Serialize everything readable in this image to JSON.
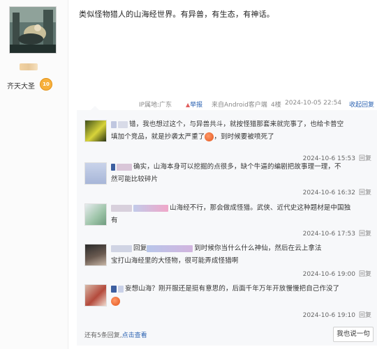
{
  "user": {
    "name": "齐天大圣",
    "level": "10"
  },
  "post": {
    "text": "类似怪物猎人的山海经世界。有异兽，有生态，有神话。"
  },
  "meta": {
    "ip_location": "IP属地:广东",
    "report": "举报",
    "client": "来自Android客户端",
    "floor": "4楼",
    "datetime": "2024-10-05 22:54",
    "collapse": "收起回复"
  },
  "replies": [
    {
      "name_fragment": "错",
      "text_a": "，我也想过这个，与异兽共斗，就按怪猎那套来就完事了，也给卡普空",
      "text_b": "填加个竞品，就是抄袭太严重了",
      "text_c": "，到时候要被喷死了",
      "time": "2024-10-6 15:53",
      "reply_label": "回复"
    },
    {
      "text_a": "确实，山海本身可以挖掘的点很多，缺个牛逼的编剧把故事理一理，不",
      "text_b": "然可能比较碎片",
      "time": "2024-10-6 16:32",
      "reply_label": "回复"
    },
    {
      "text_a": "山海经不行，那会做成怪猎。武侠、近代史这种题材是中国独",
      "text_b": "有",
      "time": "2024-10-6 17:53",
      "reply_label": "回复"
    },
    {
      "prefix": "回复",
      "text_a": "到时候你当什么什么神仙，然后在云上拿法",
      "text_b": "宝打山海经里的大怪物，很可能弄成怪猎啊",
      "time": "2024-10-6 19:00",
      "reply_label": "回复"
    },
    {
      "text_a": "妄想山海？刚开服还是挺有意思的，后面千年万年开放慢慢把自己作没了",
      "time": "2024-10-6 19:10",
      "reply_label": "回复"
    }
  ],
  "footer": {
    "more_text": "还有5条回复,",
    "view_link": "点击查看",
    "say_button": "我也说一句"
  }
}
